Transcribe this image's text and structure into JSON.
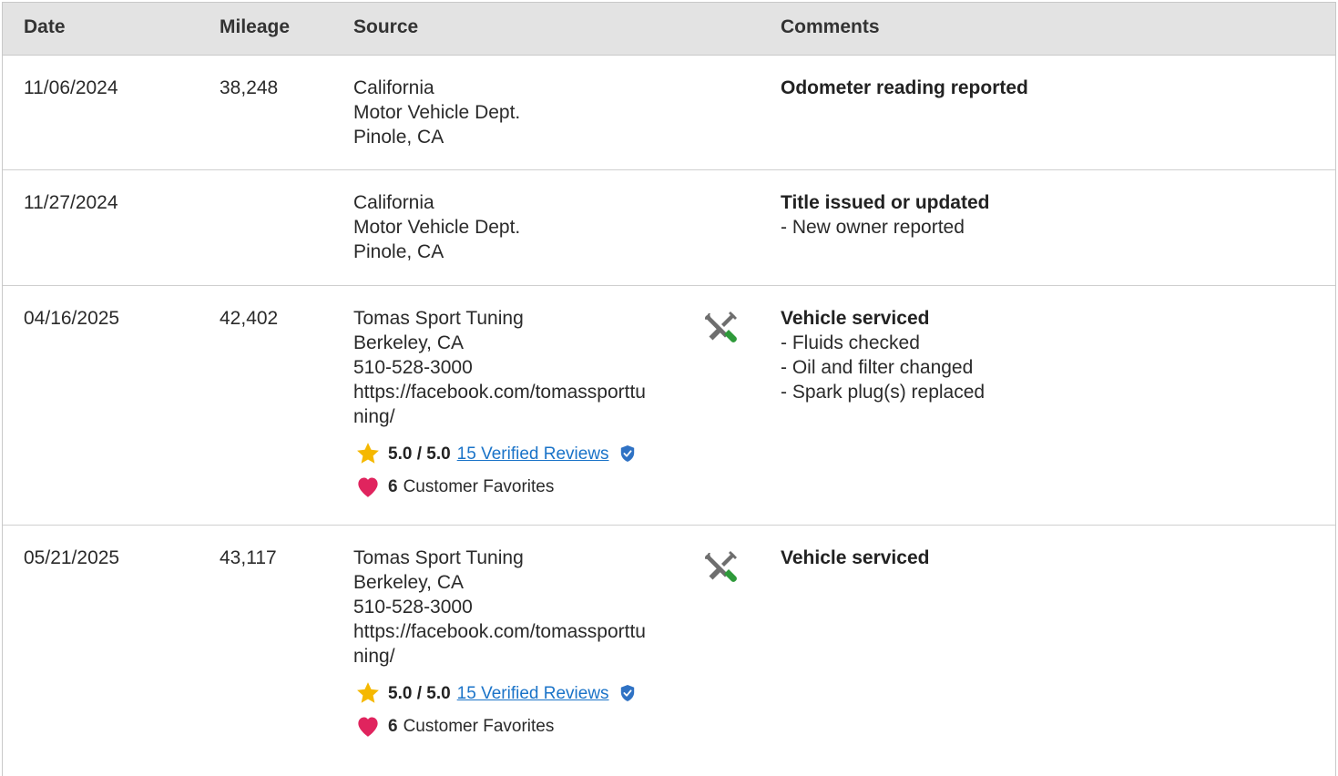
{
  "header": {
    "date": "Date",
    "mileage": "Mileage",
    "source": "Source",
    "comments": "Comments"
  },
  "rows": [
    {
      "date": "11/06/2024",
      "mileage": "38,248",
      "source": [
        "California",
        "Motor Vehicle Dept.",
        "Pinole, CA"
      ],
      "comment_title": "Odometer reading reported",
      "comment_items": []
    },
    {
      "date": "11/27/2024",
      "mileage": "",
      "source": [
        "California",
        "Motor Vehicle Dept.",
        "Pinole, CA"
      ],
      "comment_title": "Title issued or updated",
      "comment_items": [
        "- New owner reported"
      ]
    },
    {
      "date": "04/16/2025",
      "mileage": "42,402",
      "source": [
        "Tomas Sport Tuning",
        "Berkeley, CA",
        "510-528-3000",
        "https://facebook.com/tomassporttu",
        "ning/"
      ],
      "rating": "5.0 / 5.0",
      "reviews": "15 Verified Reviews",
      "favorites_count": "6",
      "favorites_label": "Customer Favorites",
      "icon": "service-tools-icon",
      "comment_title": "Vehicle serviced",
      "comment_items": [
        "- Fluids checked",
        "- Oil and filter changed",
        "- Spark plug(s) replaced"
      ]
    },
    {
      "date": "05/21/2025",
      "mileage": "43,117",
      "source": [
        "Tomas Sport Tuning",
        "Berkeley, CA",
        "510-528-3000",
        "https://facebook.com/tomassporttu",
        "ning/"
      ],
      "rating": "5.0 / 5.0",
      "reviews": "15 Verified Reviews",
      "favorites_count": "6",
      "favorites_label": "Customer Favorites",
      "icon": "service-tools-icon",
      "comment_title": "Vehicle serviced",
      "comment_items": []
    }
  ],
  "colors": {
    "header_bg": "#e3e3e3",
    "link": "#1a73c8",
    "star": "#f5b800",
    "heart": "#e0245e",
    "verified": "#2f72c4",
    "wrench_green": "#2e9a3a"
  }
}
